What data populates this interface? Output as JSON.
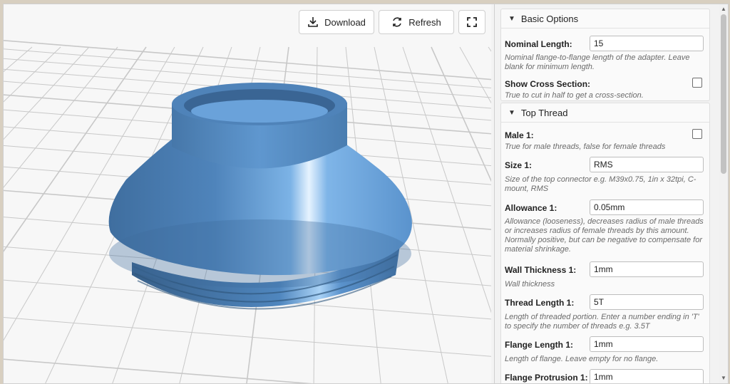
{
  "toolbar": {
    "download_label": "Download",
    "refresh_label": "Refresh"
  },
  "icons": {
    "download": "download-icon",
    "refresh": "refresh-icon",
    "fullscreen": "fullscreen-icon",
    "collapse": "triangle-down-icon"
  },
  "colors": {
    "model": "#5b93cf",
    "grid_line": "#c8c8c8",
    "viewport_bg": "#f7f7f7"
  },
  "basic_options": {
    "title": "Basic Options",
    "nominal_length": {
      "label": "Nominal Length:",
      "value": "15",
      "description": "Nominal flange-to-flange length of the adapter. Leave blank for minimum length."
    },
    "show_cross_section": {
      "label": "Show Cross Section:",
      "checked": false,
      "description": "True to cut in half to get a cross-section."
    }
  },
  "top_thread": {
    "title": "Top Thread",
    "male": {
      "label": "Male 1:",
      "checked": false,
      "description": "True for male threads, false for female threads"
    },
    "size": {
      "label": "Size 1:",
      "value": "RMS",
      "description": "Size of the top connector e.g. M39x0.75, 1in x 32tpi, C-mount, RMS"
    },
    "allowance": {
      "label": "Allowance 1:",
      "value": "0.05mm",
      "description": "Allowance (looseness), decreases radius of male threads or increases radius of female threads by this amount. Normally positive, but can be negative to compensate for material shrinkage."
    },
    "wall_thickness": {
      "label": "Wall Thickness 1:",
      "value": "1mm",
      "description": "Wall thickness"
    },
    "thread_length": {
      "label": "Thread Length 1:",
      "value": "5T",
      "description": "Length of threaded portion. Enter a number ending in 'T' to specify the number of threads e.g. 3.5T"
    },
    "flange_length": {
      "label": "Flange Length 1:",
      "value": "1mm",
      "description": "Length of flange. Leave empty for no flange."
    },
    "flange_protrusion": {
      "label": "Flange Protrusion 1:",
      "value": "1mm"
    }
  }
}
